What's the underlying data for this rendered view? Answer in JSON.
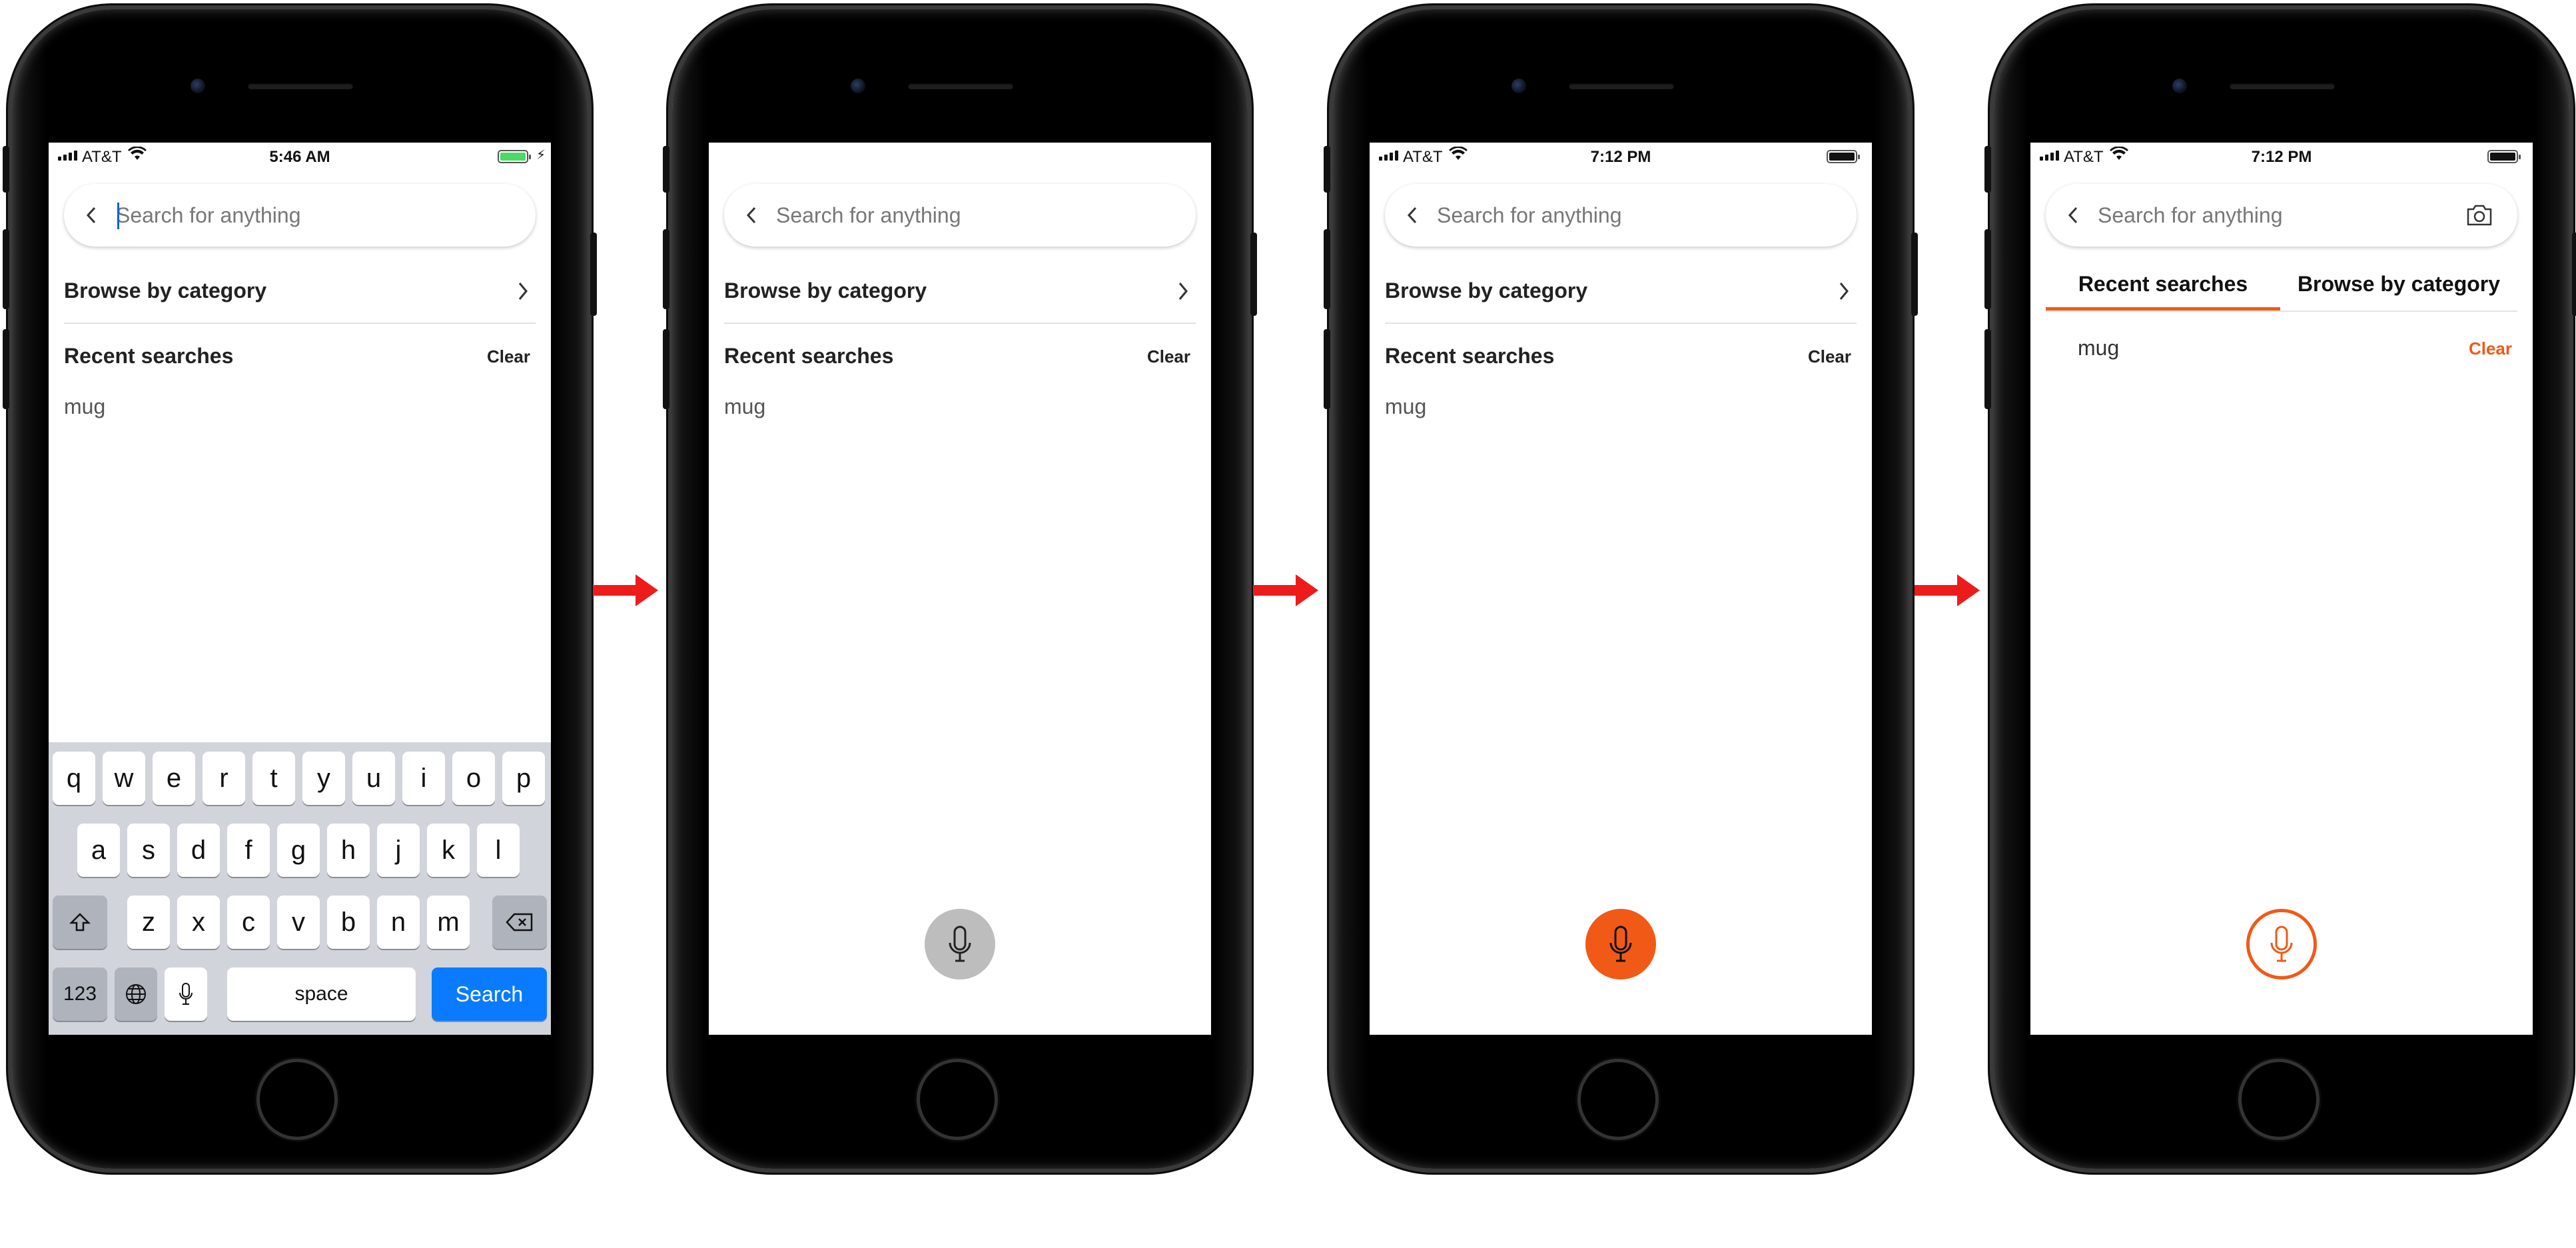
{
  "colors": {
    "accent_orange": "#f05a16",
    "mic_gray": "#bdbdbd",
    "keyboard_blue": "#0a7bff",
    "arrow_red": "#ee1b1b",
    "battery_green": "#4cd964"
  },
  "screens": [
    {
      "status": {
        "carrier": "AT&T",
        "time": "5:46 AM",
        "battery": "charging"
      },
      "search": {
        "placeholder": "Search for anything"
      },
      "browse_label": "Browse by category",
      "recent_label": "Recent searches",
      "clear_label": "Clear",
      "recent_items": [
        "mug"
      ]
    },
    {
      "search": {
        "placeholder": "Search for anything"
      },
      "browse_label": "Browse by category",
      "recent_label": "Recent searches",
      "clear_label": "Clear",
      "recent_items": [
        "mug"
      ],
      "mic_state": "inactive-gray"
    },
    {
      "status": {
        "carrier": "AT&T",
        "time": "7:12 PM",
        "battery": "full"
      },
      "search": {
        "placeholder": "Search for anything"
      },
      "browse_label": "Browse by category",
      "recent_label": "Recent searches",
      "clear_label": "Clear",
      "recent_items": [
        "mug"
      ],
      "mic_state": "active-orange"
    },
    {
      "status": {
        "carrier": "AT&T",
        "time": "7:12 PM",
        "battery": "full"
      },
      "search": {
        "placeholder": "Search for anything"
      },
      "tabs": [
        "Recent searches",
        "Browse by category"
      ],
      "recent_items": [
        "mug"
      ],
      "clear_label": "Clear",
      "mic_state": "outline-orange"
    }
  ],
  "keyboard": {
    "row1": [
      "q",
      "w",
      "e",
      "r",
      "t",
      "y",
      "u",
      "i",
      "o",
      "p"
    ],
    "row2": [
      "a",
      "s",
      "d",
      "f",
      "g",
      "h",
      "j",
      "k",
      "l"
    ],
    "row3": [
      "z",
      "x",
      "c",
      "v",
      "b",
      "n",
      "m"
    ],
    "numbers_label": "123",
    "space_label": "space",
    "search_label": "Search"
  }
}
